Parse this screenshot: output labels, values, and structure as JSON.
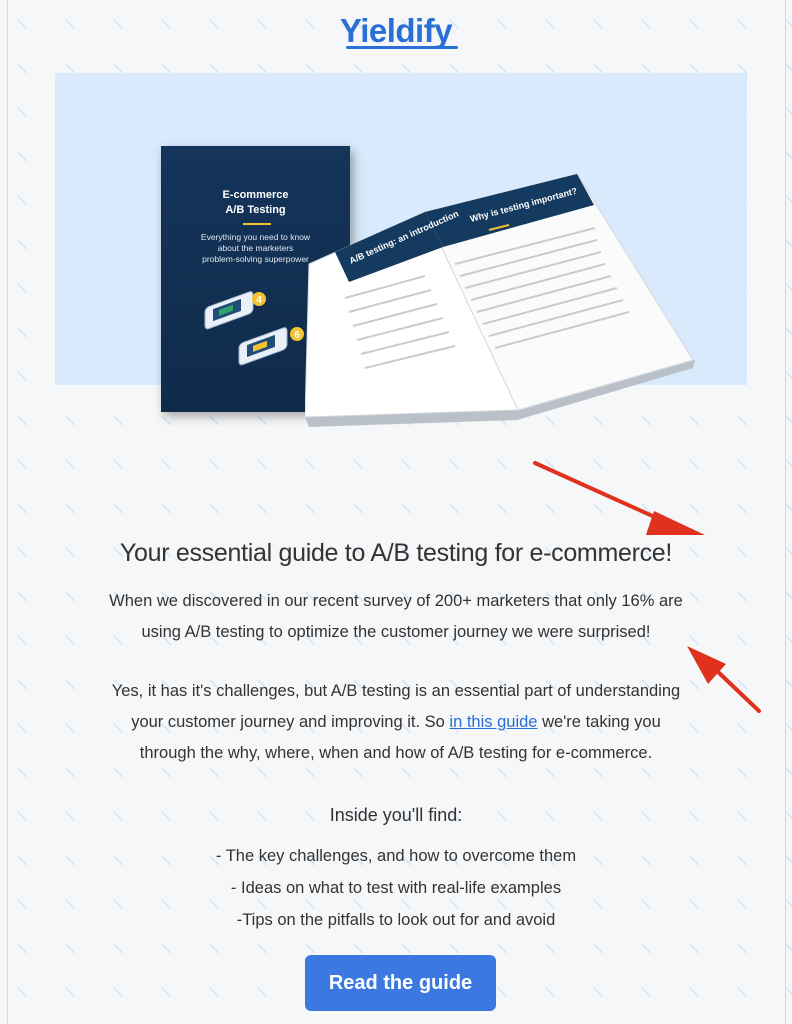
{
  "brand": {
    "logo_text": "Yieldify",
    "accent_color": "#2a6fd6"
  },
  "hero": {
    "cover": {
      "title_line1": "E-commerce",
      "title_line2": "A/B Testing",
      "subtitle_line1": "Everything you need to know",
      "subtitle_line2": "about the marketers",
      "subtitle_line3": "problem-solving superpower",
      "badge_1": "4",
      "badge_2": "6"
    },
    "open_book": {
      "left_heading": "A/B testing: an introduction",
      "right_heading": "Why is testing important?"
    },
    "background_color": "#d9eafc"
  },
  "headline": "Your essential guide to A/B testing for e-commerce!",
  "intro": {
    "line1": "When we discovered in our recent survey of 200+ marketers that only 16% are",
    "line2": "using A/B testing to optimize the customer journey we were surprised!"
  },
  "body": {
    "line1": "Yes, it has it's challenges, but A/B testing is an essential part of understanding",
    "line2_before": "your customer journey and improving it. So ",
    "line2_link": "in this guide",
    "line2_after": " we're taking you",
    "line3": "through the why, where, when and how of A/B testing for e-commerce."
  },
  "inside": {
    "heading": "Inside you'll find:",
    "items": [
      "- The key challenges, and how to overcome them",
      "- Ideas on what to test with real-life examples",
      "-Tips on the pitfalls to look out for and avoid"
    ]
  },
  "cta": {
    "label": "Read the guide",
    "color": "#3b79e0"
  },
  "annotation": {
    "arrow_color": "#e0301e",
    "arrow_count": 2
  }
}
